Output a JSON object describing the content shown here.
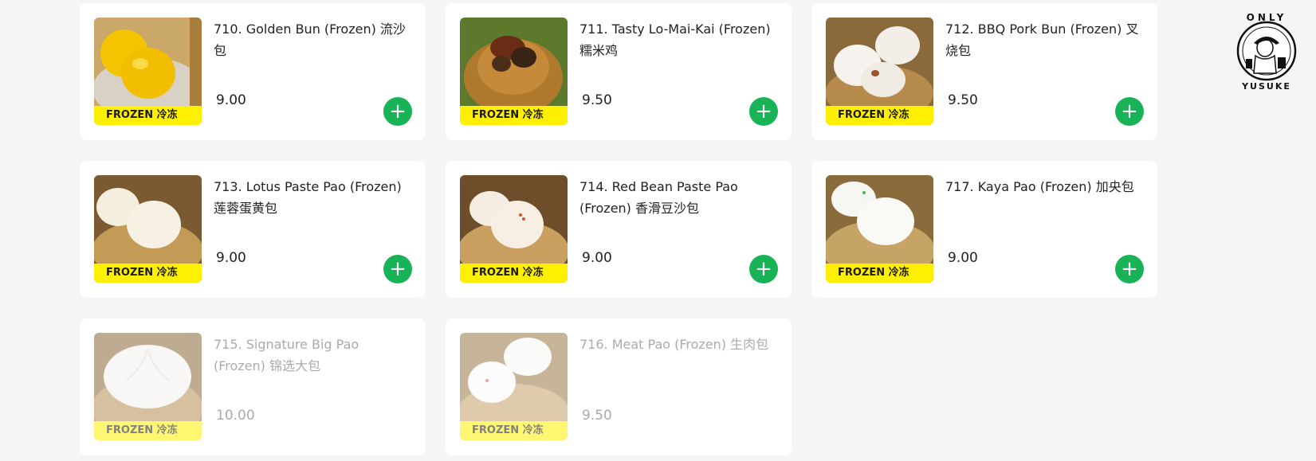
{
  "products": [
    {
      "title": "710. Golden Bun (Frozen) 流沙包",
      "price": "9.00",
      "badge": "FROZEN 冷冻",
      "image": "golden-bun",
      "available": true
    },
    {
      "title": "711. Tasty Lo-Mai-Kai (Frozen) 糯米鸡",
      "price": "9.50",
      "badge": "FROZEN 冷冻",
      "image": "lo-mai-kai",
      "available": true
    },
    {
      "title": "712. BBQ Pork Bun (Frozen) 叉烧包",
      "price": "9.50",
      "badge": "FROZEN 冷冻",
      "image": "bbq-pork-bun",
      "available": true
    },
    {
      "title": "713. Lotus Paste Pao (Frozen) 莲蓉蛋黄包",
      "price": "9.00",
      "badge": "FROZEN 冷冻",
      "image": "lotus-pao",
      "available": true
    },
    {
      "title": "714. Red Bean Paste Pao (Frozen) 香滑豆沙包",
      "price": "9.00",
      "badge": "FROZEN 冷冻",
      "image": "red-bean-pao",
      "available": true
    },
    {
      "title": "717. Kaya Pao (Frozen) 加央包",
      "price": "9.00",
      "badge": "FROZEN 冷冻",
      "image": "kaya-pao",
      "available": true
    },
    {
      "title": "715. Signature Big Pao (Frozen) 锦选大包",
      "price": "10.00",
      "badge": "FROZEN 冷冻",
      "image": "big-pao",
      "available": false
    },
    {
      "title": "716. Meat Pao (Frozen) 生肉包",
      "price": "9.50",
      "badge": "FROZEN 冷冻",
      "image": "meat-pao",
      "available": false
    }
  ],
  "add_button_label": "+",
  "watermark": {
    "top_text": "ONLY",
    "bottom_text": "YUSUKE",
    "icon": "yusuke-logo"
  },
  "colors": {
    "accent": "#17b356",
    "badge": "#ffef00",
    "card": "#ffffff",
    "background": "#f5f5f5"
  }
}
